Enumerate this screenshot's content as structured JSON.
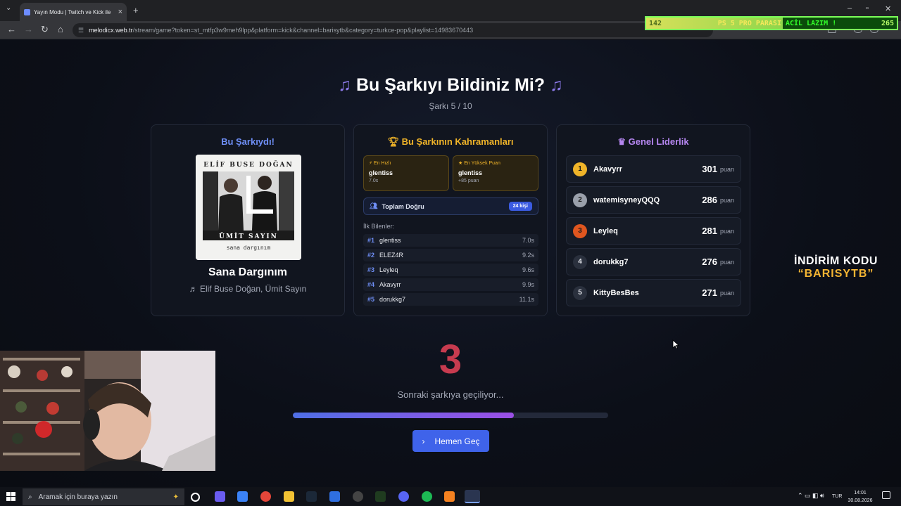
{
  "browser": {
    "tab_title": "Yayın Modu | Twitch ve Kick ile",
    "url_site": "melodicx.web.tr",
    "url_path": "/stream/game?token=st_mtfp3w9meh9lpp&platform=kick&channel=barisytb&category=turkce-pop&playlist=14983670443"
  },
  "ticker": {
    "left_number": "142",
    "middle_text": "PS 5 PRO PARASI",
    "message": "ACİL LAZIM !",
    "right_number": "265"
  },
  "game": {
    "title": "Bu Şarkıyı Bildiniz Mi?",
    "title_icon": "music-note-icon",
    "progress_label": "Şarkı 5 / 10"
  },
  "song_card": {
    "title": "Bu Şarkıydı!",
    "cover_top_text": "ELİF BUSE DOĞAN",
    "cover_bottom_text": "ÜMİT SAYIN",
    "cover_caption": "sana dargınım",
    "song_name": "Sana Dargınım",
    "artists": "♬ Elif Buse Doğan, Ümit Sayın"
  },
  "heroes_card": {
    "title": "Bu Şarkının Kahramanları",
    "fastest": {
      "label": "En Hızlı",
      "name": "glentiss",
      "detail": "7.0s"
    },
    "highest": {
      "label": "En Yüksek Puan",
      "name": "glentiss",
      "detail": "+85 puan"
    },
    "total_label": "Toplam Doğru",
    "total_badge": "24 kişi",
    "first_label": "İlk Bilenler:",
    "first_guessers": [
      {
        "rank": "#1",
        "name": "glentiss",
        "time": "7.0s"
      },
      {
        "rank": "#2",
        "name": "ELEZ4R",
        "time": "9.2s"
      },
      {
        "rank": "#3",
        "name": "Leyleq",
        "time": "9.6s"
      },
      {
        "rank": "#4",
        "name": "Akavyrr",
        "time": "9.9s"
      },
      {
        "rank": "#5",
        "name": "dorukkg7",
        "time": "11.1s"
      }
    ]
  },
  "leaderboard": {
    "title": "Genel Liderlik",
    "unit": "puan",
    "rows": [
      {
        "rank": "1",
        "name": "Akavyrr",
        "points": "301",
        "color": "#f0b429"
      },
      {
        "rank": "2",
        "name": "watemisyneyQQQ",
        "points": "286",
        "color": "#9aa0ab"
      },
      {
        "rank": "3",
        "name": "Leyleq",
        "points": "281",
        "color": "#e0561f"
      },
      {
        "rank": "4",
        "name": "dorukkg7",
        "points": "276",
        "color": "#2a303d"
      },
      {
        "rank": "5",
        "name": "KittyBesBes",
        "points": "271",
        "color": "#2a303d"
      }
    ]
  },
  "transition": {
    "countdown": "3",
    "message": "Sonraki şarkıya geçiliyor...",
    "progress": 0.7,
    "skip_label": "Hemen Geç"
  },
  "promo": {
    "line1": "İNDİRİM KODU",
    "line2": "“BARISYTB”"
  },
  "taskbar": {
    "search_placeholder": "Aramak için buraya yazın",
    "language": "TUR",
    "time": "14:01",
    "date": "30.08.2026"
  },
  "colors": {
    "accent_blue": "#3f63ea",
    "gold": "#f0b429",
    "purple": "#b586f0",
    "countdown_red": "#c73b4f"
  }
}
